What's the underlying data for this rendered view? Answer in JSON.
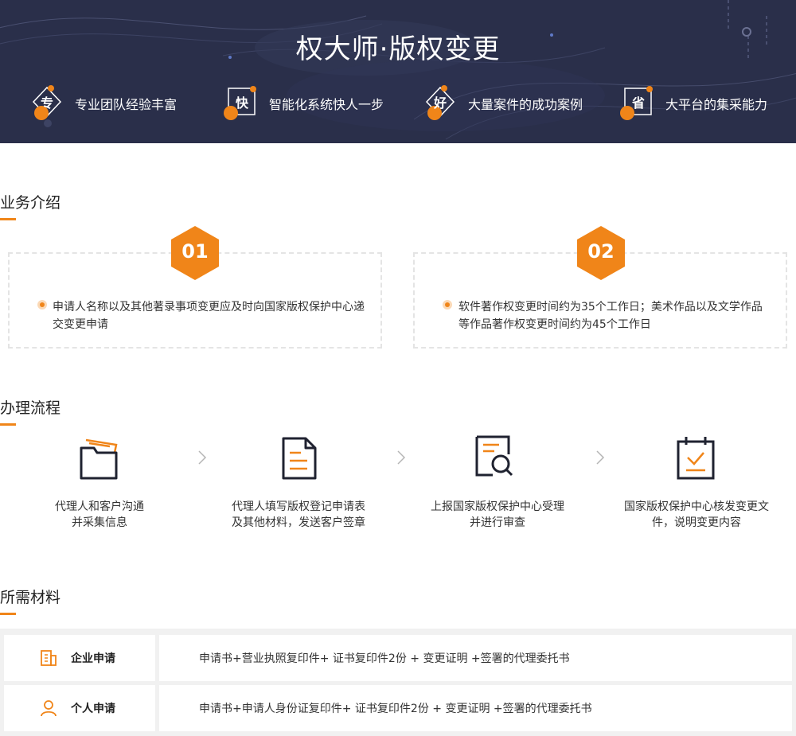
{
  "banner": {
    "title": "权大师·版权变更",
    "features": [
      {
        "badge": "专",
        "label": "专业团队经验丰富",
        "icon": "diamond-badge-icon"
      },
      {
        "badge": "快",
        "label": "智能化系统快人一步",
        "icon": "square-badge-icon"
      },
      {
        "badge": "好",
        "label": "大量案件的成功案例",
        "icon": "diamond-badge-icon"
      },
      {
        "badge": "省",
        "label": "大平台的集采能力",
        "icon": "square-badge-icon"
      }
    ]
  },
  "intro": {
    "title": "业务介绍",
    "cards": [
      {
        "num": "01",
        "text": "申请人名称以及其他著录事项变更应及时向国家版权保护中心递交变更申请"
      },
      {
        "num": "02",
        "text": "软件著作权变更时间约为35个工作日；美术作品以及文学作品等作品著作权变更时间约为45个工作日"
      }
    ]
  },
  "process": {
    "title": "办理流程",
    "steps": [
      {
        "icon": "folder-icon",
        "line1": "代理人和客户沟通",
        "line2": "并采集信息"
      },
      {
        "icon": "document-icon",
        "line1": "代理人填写版权登记申请表",
        "line2": "及其他材料，发送客户签章"
      },
      {
        "icon": "document-search-icon",
        "line1": "上报国家版权保护中心受理",
        "line2": "并进行审查"
      },
      {
        "icon": "calendar-check-icon",
        "line1": "国家版权保护中心核发变更文",
        "line2": "件，说明变更内容"
      }
    ]
  },
  "materials": {
    "title": "所需材料",
    "rows": [
      {
        "icon": "building-icon",
        "name": "企业申请",
        "desc": "申请书+营业执照复印件+ 证书复印件2份 + 变更证明 +签署的代理委托书"
      },
      {
        "icon": "person-icon",
        "name": "个人申请",
        "desc": "申请书+申请人身份证复印件+ 证书复印件2份 + 变更证明 +签署的代理委托书"
      }
    ]
  },
  "colors": {
    "accent": "#f08519",
    "banner_bg": "#2a2f4a",
    "icon_dark": "#1f2230"
  }
}
